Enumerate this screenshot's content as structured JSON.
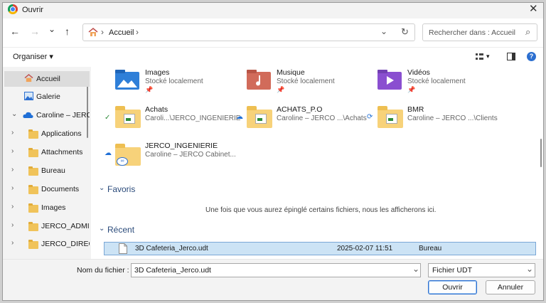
{
  "window": {
    "title": "Ouvrir",
    "close_glyph": "✕"
  },
  "nav": {
    "back": "←",
    "forward": "→",
    "recent": "⌄",
    "up": "↑"
  },
  "address": {
    "home_icon": "home-icon",
    "sep": "›",
    "crumb": "Accueil",
    "dropdown": "⌄",
    "refresh": "↻"
  },
  "search": {
    "placeholder": "Rechercher dans : Accueil",
    "icon": "⌕"
  },
  "toolbar": {
    "organiser": "Organiser ▾",
    "view_label": "▾",
    "help": "?"
  },
  "sidebar": {
    "items": [
      {
        "label": "Accueil",
        "icon": "home-icon"
      },
      {
        "label": "Galerie",
        "icon": "gallery-icon"
      },
      {
        "label": "Caroline – JERCO",
        "icon": "cloud-icon",
        "chevron": "⌄"
      },
      {
        "label": "Applications",
        "chevron": "›"
      },
      {
        "label": "Attachments",
        "chevron": "›"
      },
      {
        "label": "Bureau",
        "chevron": "›"
      },
      {
        "label": "Documents",
        "chevron": "›"
      },
      {
        "label": "Images",
        "chevron": "›"
      },
      {
        "label": "JERCO_ADMIN",
        "chevron": "›"
      },
      {
        "label": "JERCO_DIRECT",
        "chevron": "›"
      }
    ]
  },
  "quick_access": [
    {
      "name": "Images",
      "sub": "Stocké localement",
      "pin": "📌"
    },
    {
      "name": "Musique",
      "sub": "Stocké localement",
      "pin": "📌"
    },
    {
      "name": "Vidéos",
      "sub": "Stocké localement",
      "pin": "📌"
    },
    {
      "name": "Achats",
      "sub": "Caroli...\\JERCO_INGENIERIE",
      "status": "✓"
    },
    {
      "name": "ACHATS_P.O",
      "sub": "Caroline – JERCO ...\\Achats",
      "status": "☁"
    },
    {
      "name": "BMR",
      "sub": "Caroline – JERCO ...\\Clients",
      "status": "⟳"
    },
    {
      "name": "JERCO_INGENIERIE",
      "sub": "Caroline – JERCO Cabinet...",
      "status": "☁"
    }
  ],
  "favoris": {
    "label": "Favoris",
    "chevron": "⌄",
    "empty": "Une fois que vous aurez épinglé certains fichiers, nous les afficherons ici."
  },
  "recent": {
    "label": "Récent",
    "chevron": "⌄",
    "rows": [
      {
        "name": "3D Cafeteria_Jerco.udt",
        "date": "2025-02-07 11:51",
        "location": "Bureau"
      }
    ]
  },
  "footer": {
    "filename_label": "Nom du fichier :",
    "filename_value": "3D Cafeteria_Jerco.udt",
    "filetype": "Fichier UDT",
    "dropdown": "⌄",
    "open": "Ouvrir",
    "cancel": "Annuler"
  },
  "colors": {
    "accent": "#2c6fd0",
    "selection": "#cce3f5",
    "folder": "#f7d27a"
  }
}
